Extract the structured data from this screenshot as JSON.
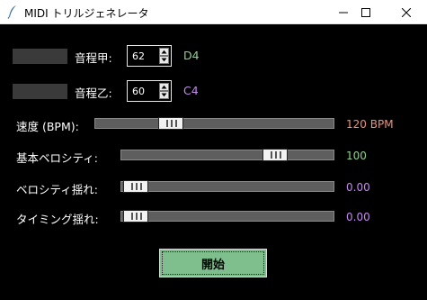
{
  "window": {
    "title": "MIDI トリルジェネレータ",
    "icons": {
      "app": "feather-icon",
      "minimize": "minimize-icon",
      "maximize": "maximize-icon",
      "close": "close-icon"
    }
  },
  "pitch_a": {
    "label": "音程甲:",
    "value": "62",
    "note": "D4",
    "note_color": "#8fd18f"
  },
  "pitch_b": {
    "label": "音程乙:",
    "value": "60",
    "note": "C4",
    "note_color": "#c58af0"
  },
  "sliders": [
    {
      "label": "速度 (BPM):",
      "display": "120 BPM",
      "color": "#f0907a",
      "level_fraction": 0.29
    },
    {
      "label": "基本ベロシティ:",
      "display": "100",
      "color": "#8fd18f",
      "level_fraction": 0.76
    },
    {
      "label": "ベロシティ揺れ:",
      "display": "0.00",
      "color": "#c58af0",
      "level_fraction": 0.0
    },
    {
      "label": "タイミング揺れ:",
      "display": "0.00",
      "color": "#c58af0",
      "level_fraction": 0.0
    }
  ],
  "start_button": {
    "label": "開始",
    "color": "#7fbf8e"
  }
}
